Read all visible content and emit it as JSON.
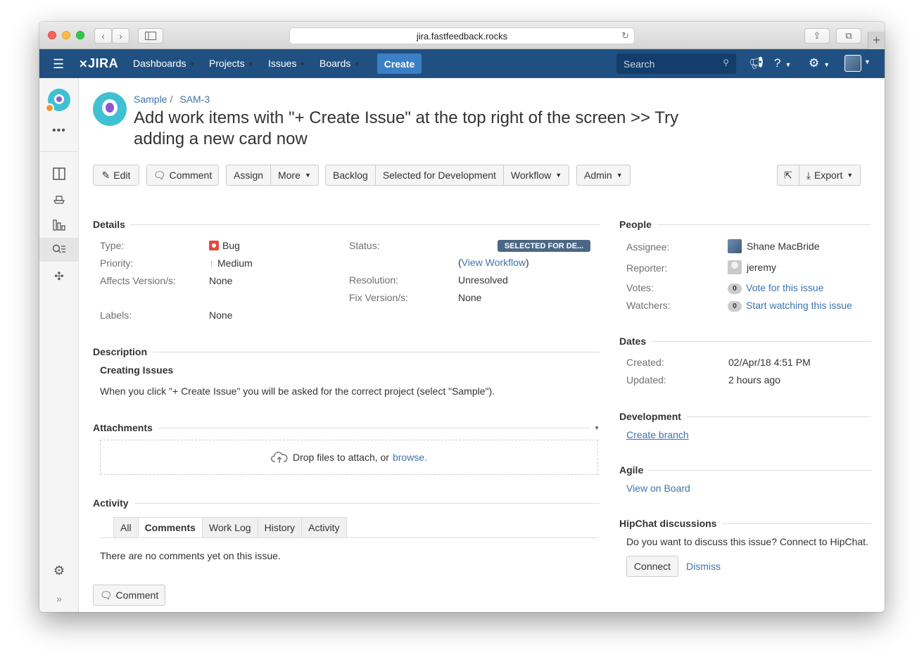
{
  "browser": {
    "url": "jira.fastfeedback.rocks",
    "back_icon": "‹",
    "forward_icon": "›",
    "reload_icon": "↻",
    "share_icon": "⇪",
    "tabs_icon": "⧉",
    "newtab_icon": "+"
  },
  "topnav": {
    "logo": "JIRA",
    "items": [
      "Dashboards",
      "Projects",
      "Issues",
      "Boards"
    ],
    "create_label": "Create",
    "search_placeholder": "Search",
    "brand_color": "#205081"
  },
  "breadcrumb": {
    "project": "Sample",
    "sep": "/",
    "issue_key": "SAM-3"
  },
  "issue": {
    "title": "Add work items with \"+ Create Issue\" at the top right of the screen >> Try adding a new card now"
  },
  "toolbar": {
    "edit": "Edit",
    "comment": "Comment",
    "assign": "Assign",
    "more": "More",
    "backlog": "Backlog",
    "selected_for_dev": "Selected for Development",
    "workflow": "Workflow",
    "admin": "Admin",
    "export": "Export"
  },
  "details": {
    "heading": "Details",
    "type_label": "Type:",
    "type_value": "Bug",
    "priority_label": "Priority:",
    "priority_value": "Medium",
    "affects_label": "Affects Version/s:",
    "affects_value": "None",
    "labels_label": "Labels:",
    "labels_value": "None",
    "status_label": "Status:",
    "status_value": "SELECTED FOR DE...",
    "view_workflow": "View Workflow",
    "resolution_label": "Resolution:",
    "resolution_value": "Unresolved",
    "fix_label": "Fix Version/s:",
    "fix_value": "None"
  },
  "description": {
    "heading": "Description",
    "subheading": "Creating Issues",
    "text": "When you click \"+ Create Issue\" you will be asked for the correct project (select \"Sample\")."
  },
  "attachments": {
    "heading": "Attachments",
    "drop_text": "Drop files to attach, or",
    "browse": "browse."
  },
  "activity": {
    "heading": "Activity",
    "tabs": [
      "All",
      "Comments",
      "Work Log",
      "History",
      "Activity"
    ],
    "active_tab": "Comments",
    "empty_text": "There are no comments yet on this issue.",
    "comment_button": "Comment"
  },
  "people": {
    "heading": "People",
    "assignee_label": "Assignee:",
    "assignee_value": "Shane MacBride",
    "reporter_label": "Reporter:",
    "reporter_value": "jeremy",
    "votes_label": "Votes:",
    "votes_count": "0",
    "votes_link": "Vote for this issue",
    "watchers_label": "Watchers:",
    "watchers_count": "0",
    "watchers_link": "Start watching this issue"
  },
  "dates": {
    "heading": "Dates",
    "created_label": "Created:",
    "created_value": "02/Apr/18 4:51 PM",
    "updated_label": "Updated:",
    "updated_value": "2 hours ago"
  },
  "development": {
    "heading": "Development",
    "create_branch": "Create branch"
  },
  "agile": {
    "heading": "Agile",
    "view_on_board": "View on Board"
  },
  "hipchat": {
    "heading": "HipChat discussions",
    "text": "Do you want to discuss this issue? Connect to HipChat.",
    "connect": "Connect",
    "dismiss": "Dismiss"
  }
}
